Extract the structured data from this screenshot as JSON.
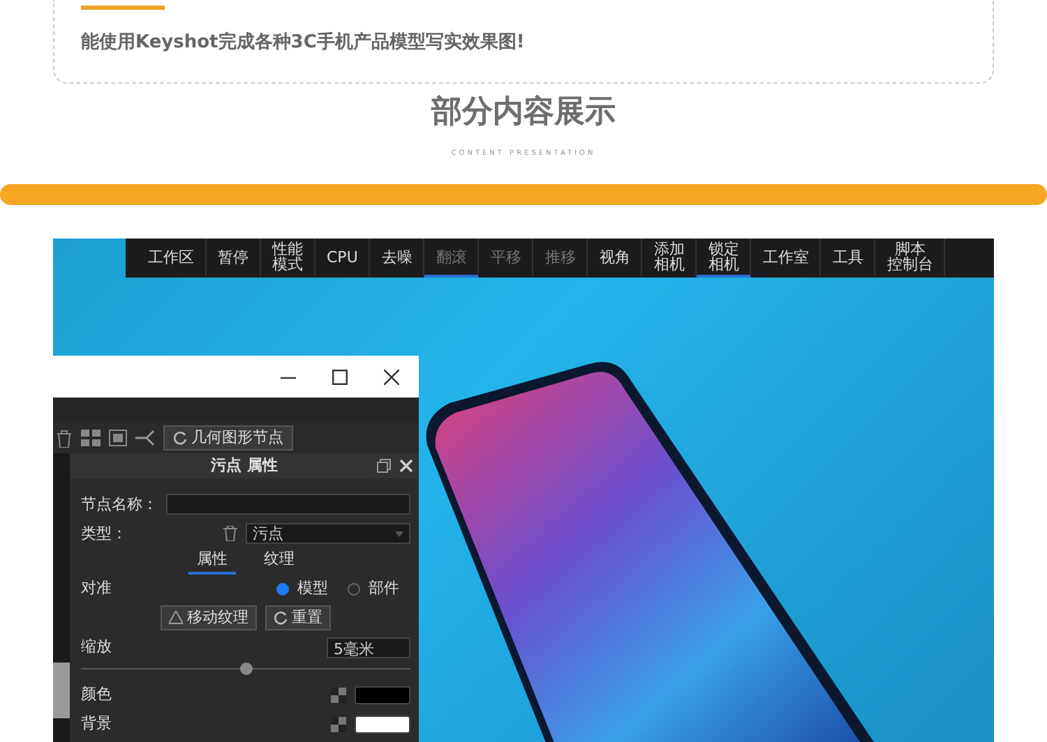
{
  "intro_card": {
    "text": "能使用Keyshot完成各种3C手机产品模型写实效果图!"
  },
  "section": {
    "title": "部分内容展示",
    "subtitle": "CONTENT PRESENTATION"
  },
  "screen": {
    "toolbar": [
      {
        "label": "工作区",
        "selected": false,
        "disabled": false
      },
      {
        "label": "暂停",
        "selected": false,
        "disabled": false
      },
      {
        "label": "性能模式",
        "selected": false,
        "disabled": false,
        "two_line": true
      },
      {
        "label": "CPU",
        "selected": false,
        "disabled": false
      },
      {
        "label": "去噪",
        "selected": false,
        "disabled": false
      },
      {
        "label": "翻滚",
        "selected": true,
        "disabled": true
      },
      {
        "label": "平移",
        "selected": false,
        "disabled": true
      },
      {
        "label": "推移",
        "selected": false,
        "disabled": true
      },
      {
        "label": "视角",
        "selected": false,
        "disabled": false
      },
      {
        "label": "添加相机",
        "selected": false,
        "disabled": false,
        "two_line": true
      },
      {
        "label": "锁定相机",
        "selected": true,
        "disabled": false,
        "two_line": true
      },
      {
        "label": "工作室",
        "selected": false,
        "disabled": false
      },
      {
        "label": "工具",
        "selected": false,
        "disabled": false
      },
      {
        "label": "脚本控制台",
        "selected": false,
        "disabled": false,
        "two_line": true
      }
    ],
    "panel": {
      "node_button": "几何图形节点",
      "title": "污点 属性",
      "node_name": {
        "label": "节点名称："
      },
      "type": {
        "label": "类型：",
        "value": "污点"
      },
      "tabs": [
        {
          "label": "属性",
          "selected": true
        },
        {
          "label": "纹理",
          "selected": false
        }
      ],
      "align": {
        "label": "对准",
        "options": [
          {
            "label": "模型",
            "selected": true
          },
          {
            "label": "部件",
            "selected": false
          }
        ]
      },
      "buttons": [
        "移动纹理",
        "重置"
      ],
      "scale": {
        "label": "缩放",
        "value": "5毫米",
        "level": 0.5
      },
      "colors": [
        {
          "label": "颜色",
          "color": "#000000"
        },
        {
          "label": "背景",
          "color": "#ffffff"
        }
      ]
    }
  }
}
